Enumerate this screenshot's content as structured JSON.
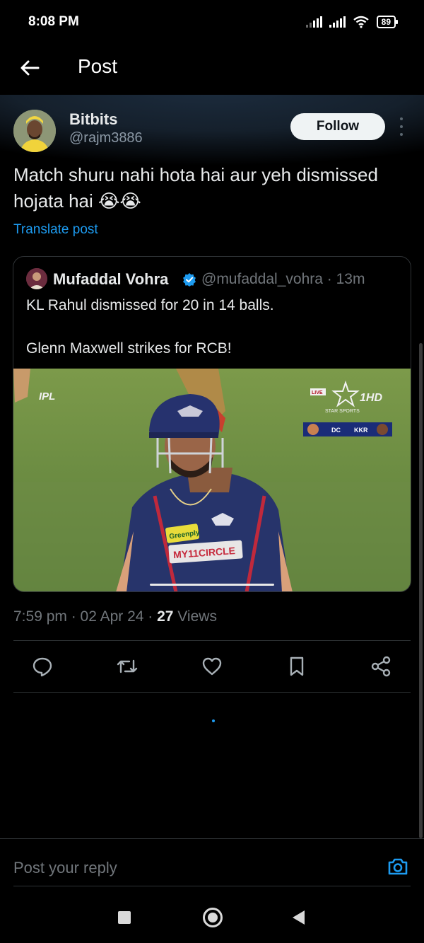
{
  "status_bar": {
    "time": "8:08 PM",
    "battery": "89"
  },
  "app_bar": {
    "title": "Post"
  },
  "post": {
    "author": {
      "name": "Bitbits",
      "handle": "@rajm3886"
    },
    "follow_label": "Follow",
    "text": "Match shuru nahi hota hai aur yeh dismissed hojata hai 😭😭",
    "translate_label": "Translate post",
    "quote": {
      "name": "Mufaddal Vohra",
      "handle_time": "@mufaddal_vohra · 13m",
      "line1": "KL Rahul dismissed for 20 in 14 balls.",
      "line2": "Glenn Maxwell strikes for RCB!",
      "media": {
        "ipl_logo": "IPL",
        "live_badge": "LIVE",
        "channel": "1HD",
        "channel_sub": "STAR SPORTS",
        "team1": "DC",
        "team2": "KKR",
        "jersey_sponsor1": "Greenply",
        "jersey_sponsor2": "MY11CIRCLE"
      }
    },
    "timestamp": "7:59 pm · 02 Apr 24 · ",
    "views_count": "27",
    "views_label": " Views"
  },
  "actions": [
    "reply-icon",
    "repost-icon",
    "like-icon",
    "bookmark-icon",
    "share-icon"
  ],
  "reply": {
    "placeholder": "Post your reply"
  },
  "colors": {
    "accent": "#1d9bf0",
    "background": "#000000",
    "muted": "#71767b",
    "border": "#2f3336"
  }
}
